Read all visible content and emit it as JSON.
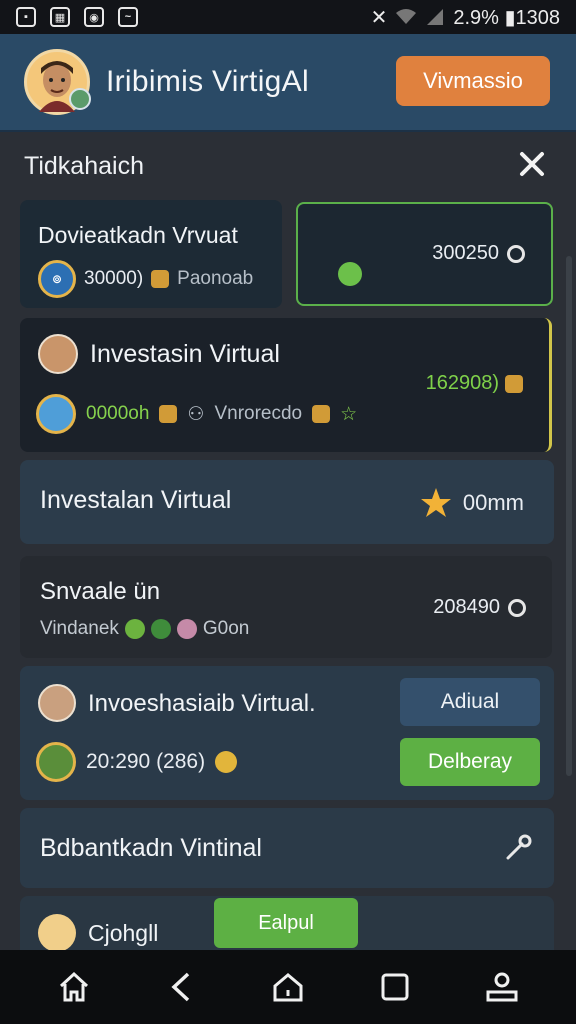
{
  "status_bar": {
    "left_icons": [
      "image-icon",
      "calendar-icon",
      "gamepad-icon",
      "message-icon"
    ],
    "right_text": "2.9% ▮1308"
  },
  "header": {
    "title": "Iribimis VirtigAl",
    "button_label": "Vivmassio"
  },
  "section": {
    "title": "Tidkahaich"
  },
  "cards": {
    "c1_left": {
      "title": "Dovieatkadn Vrvuat",
      "value": "30000)",
      "sub": "Paonoab"
    },
    "c1_right": {
      "value": "300250"
    },
    "c2": {
      "title": "Investasin Virtual",
      "value": "162908)",
      "amount": "0000oh",
      "sub": "Vnrorecdo"
    },
    "c3": {
      "title": "Investalan Virtual",
      "value": "00mm"
    },
    "c4": {
      "title": "Snvaale ün",
      "sub": "Vindanek",
      "sub2": "G0on",
      "value": "208490"
    },
    "c5": {
      "title": "Invoeshasiaib Virtual.",
      "amount": "20:290 (286)",
      "btn1": "Adiual",
      "btn2": "Delberay"
    },
    "c6": {
      "title": "Bdbantkadn Vintinal"
    },
    "c7": {
      "title": "Cjohgll",
      "btn": "Ealpul"
    }
  },
  "colors": {
    "header_bg": "#2a4a66",
    "accent_orange": "#e0813e",
    "accent_green": "#5db044",
    "page_bg": "#2b2f36"
  }
}
